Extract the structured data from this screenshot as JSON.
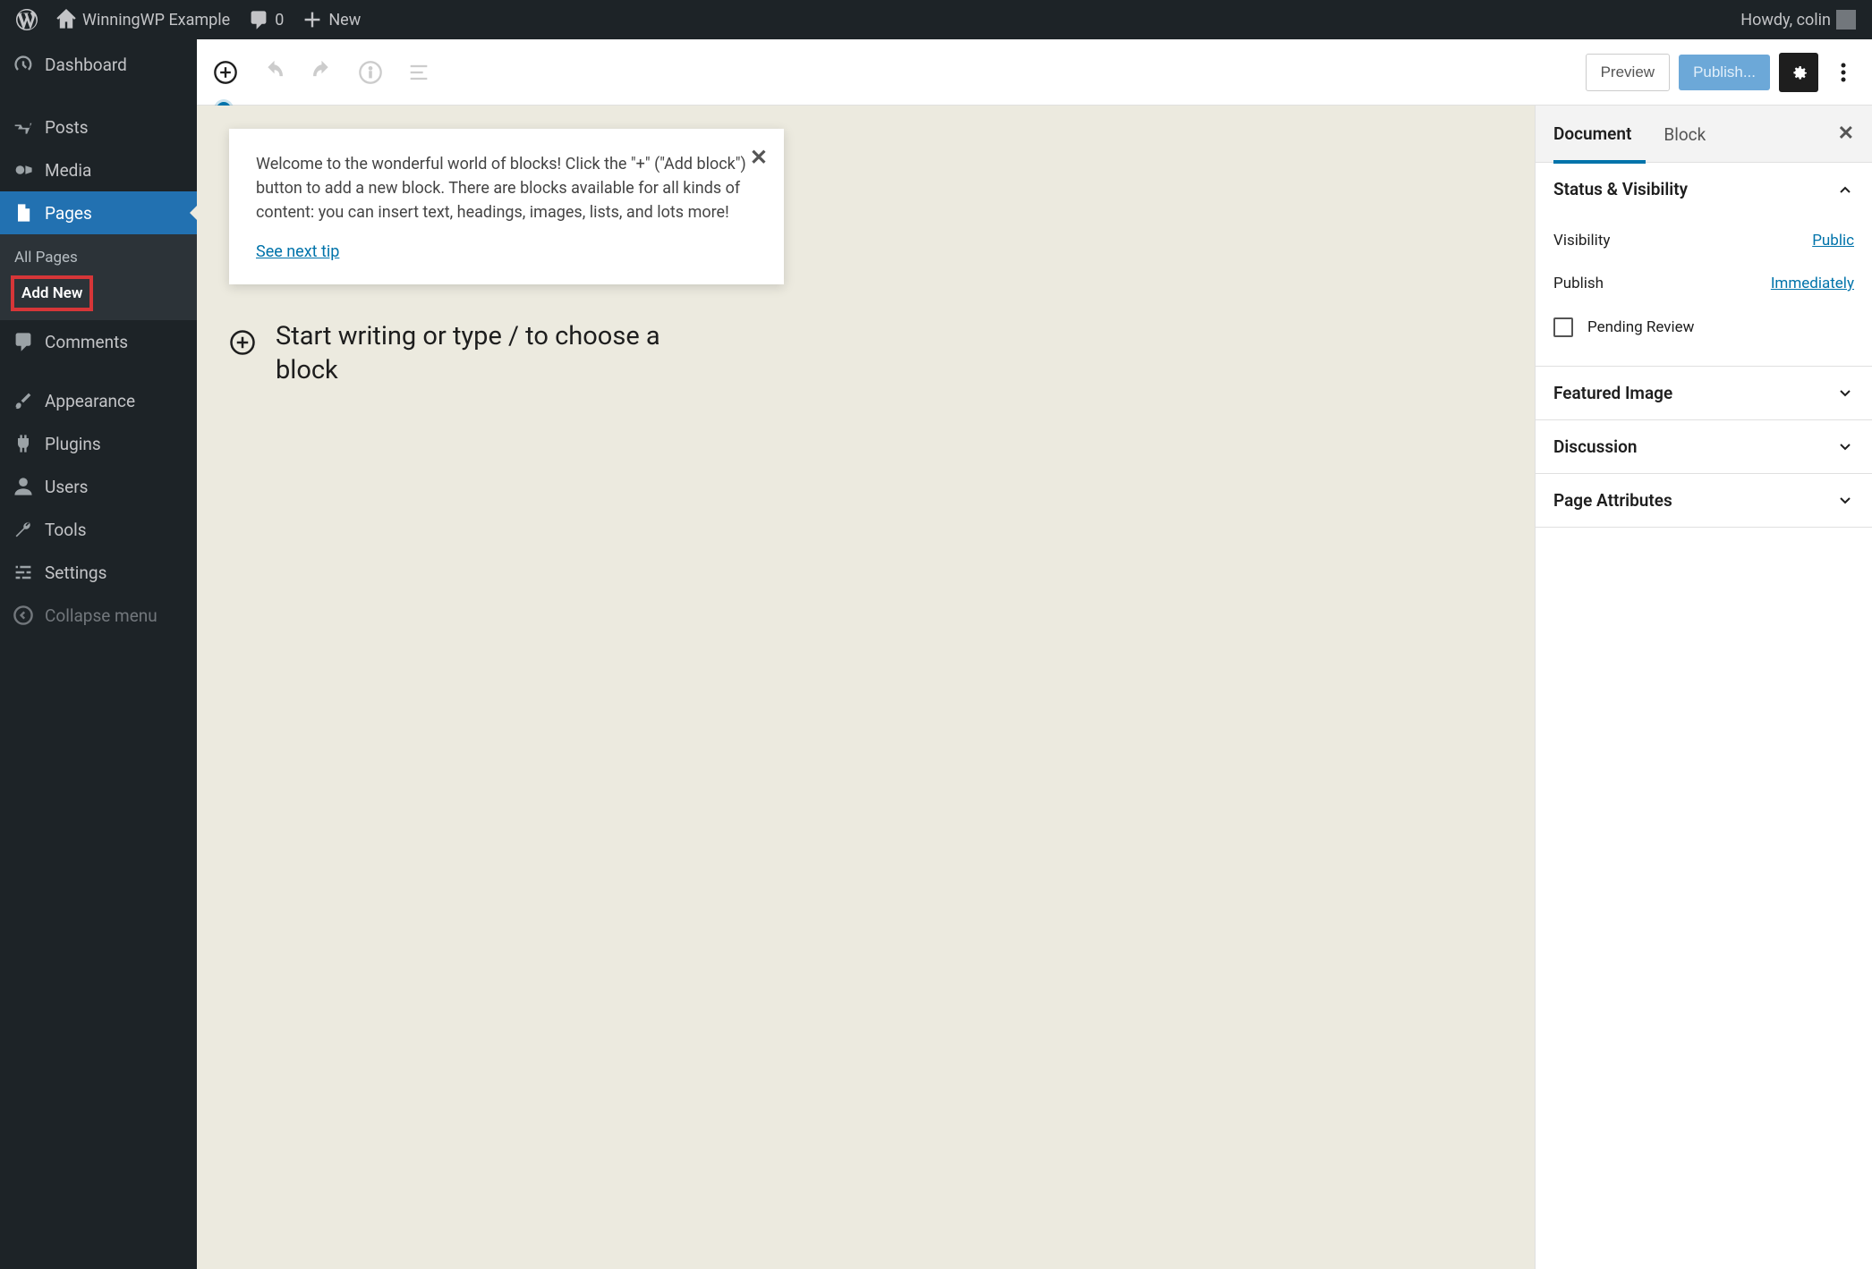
{
  "admin_bar": {
    "site_title": "WinningWP Example",
    "comments_count": "0",
    "new_label": "New",
    "greeting": "Howdy, colin"
  },
  "sidebar": {
    "dashboard": "Dashboard",
    "posts": "Posts",
    "media": "Media",
    "pages": "Pages",
    "pages_sub_all": "All Pages",
    "pages_sub_add": "Add New",
    "comments": "Comments",
    "appearance": "Appearance",
    "plugins": "Plugins",
    "users": "Users",
    "tools": "Tools",
    "settings": "Settings",
    "collapse": "Collapse menu"
  },
  "toolbar": {
    "preview": "Preview",
    "publish": "Publish..."
  },
  "tip": {
    "text": "Welcome to the wonderful world of blocks! Click the \"+\" (\"Add block\") button to add a new block. There are blocks available for all kinds of content: you can insert text, headings, images, lists, and lots more!",
    "next": "See next tip"
  },
  "editor": {
    "placeholder": "Start writing or type / to choose a block"
  },
  "panel": {
    "tabs": {
      "document": "Document",
      "block": "Block"
    },
    "status_visibility": "Status & Visibility",
    "visibility_label": "Visibility",
    "visibility_value": "Public",
    "publish_label": "Publish",
    "publish_value": "Immediately",
    "pending_review": "Pending Review",
    "featured_image": "Featured Image",
    "discussion": "Discussion",
    "page_attributes": "Page Attributes"
  }
}
